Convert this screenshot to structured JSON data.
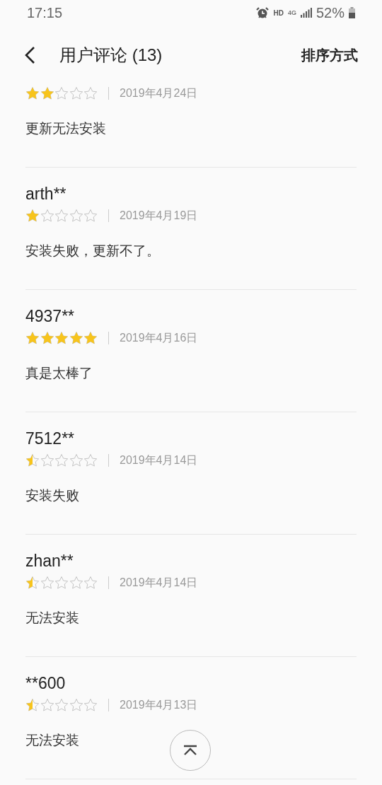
{
  "status_bar": {
    "time": "17:15",
    "network": "HD",
    "signal_type": "4G",
    "battery": "52%"
  },
  "header": {
    "title": "用户评论 (13)",
    "sort_button": "排序方式"
  },
  "reviews": [
    {
      "stars": 2,
      "date": "2019年4月24日",
      "text": "更新无法安装"
    },
    {
      "name": "arth**",
      "stars": 1,
      "date": "2019年4月19日",
      "text": "安装失败，更新不了。"
    },
    {
      "name": "4937**",
      "stars": 5,
      "date": "2019年4月16日",
      "text": "真是太棒了"
    },
    {
      "name": "7512**",
      "stars": 0.5,
      "date": "2019年4月14日",
      "text": "安装失败"
    },
    {
      "name": "zhan**",
      "stars": 0.5,
      "date": "2019年4月14日",
      "text": "无法安装"
    },
    {
      "name": "**600",
      "stars": 0.5,
      "date": "2019年4月13日",
      "text": "无法安装"
    }
  ]
}
